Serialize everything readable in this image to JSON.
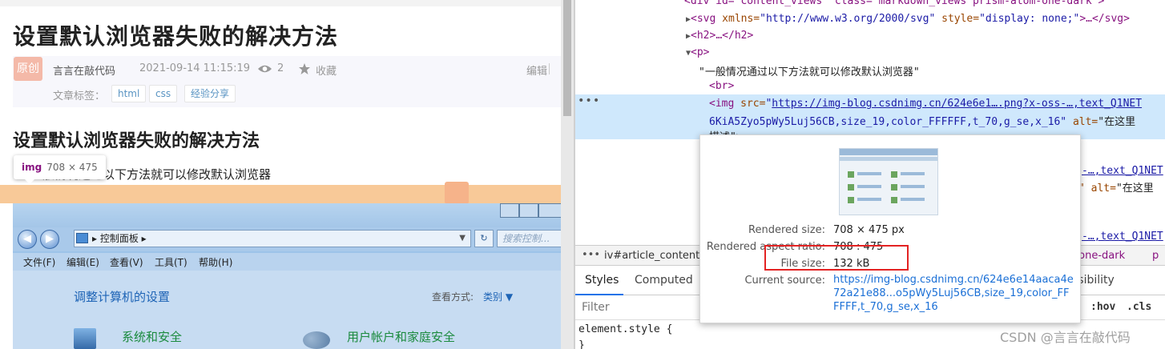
{
  "blog": {
    "title": "设置默认浏览器失败的解决方法",
    "original_badge": "原创",
    "author": "言言在敲代码",
    "datetime": "2021-09-14 11:15:19",
    "views": "2",
    "favorite": "收藏",
    "edit": "编辑",
    "tags_label": "文章标签：",
    "tags": [
      "html",
      "css",
      "经验分享"
    ],
    "section_heading": "设置默认浏览器失败的解决方法",
    "intro_text": "一般情况通过以下方法就可以修改默认浏览器",
    "img_tooltip": {
      "tag": "img",
      "dims": "708 × 475"
    }
  },
  "control_panel": {
    "address": "控制面板",
    "search_placeholder": "搜索控制...",
    "menu": [
      "文件(F)",
      "编辑(E)",
      "查看(V)",
      "工具(T)",
      "帮助(H)"
    ],
    "heading": "调整计算机的设置",
    "view_mode_label": "查看方式:",
    "view_mode_value": "类别 ▼",
    "system_security": "系统和安全",
    "user_accounts": "用户帐户和家庭安全"
  },
  "devtools": {
    "lines": {
      "l0": "<div id=\"content_views\" class=\"markdown_views prism-atom-one-dark\">",
      "l1_tag": "<svg ",
      "l1_attr": "xmlns=",
      "l1_val": "\"http://www.w3.org/2000/svg\"",
      "l1_attr2": " style=",
      "l1_val2": "\"display: none;\"",
      "l1_end": ">…</svg>",
      "l2": "<h2>…</h2>",
      "l3": "<p>",
      "l4_text": "\"一般情况通过以下方法就可以修改默认浏览器\"",
      "l5": "<br>",
      "l6_tag": "<img ",
      "l6_attr": "src=",
      "l6_link": "https://img-blog.csdnimg.cn/624e6e1….png?x-oss-…,text_Q1NET",
      "l7_val": "6KiA5Zyo5pWy5Luj56CB,size_19,color_FFFFFF,t_70,g_se,x_16\"",
      "l7_attr": " alt=",
      "l7_txt": "\"在这里",
      "l8_txt": "描述\">",
      "r1": "-…,text_Q1NET",
      "r2_attr": "\"  alt=",
      "r2_txt": "\"在这里",
      "r3": "-…,text_Q1NET"
    },
    "breadcrumb": "iv#article_content.",
    "breadcrumb_right": "n-one-dark",
    "breadcrumb_p": "p",
    "tabs": {
      "styles": "Styles",
      "computed": "Computed",
      "accessibility": "ssibility"
    },
    "filter_placeholder": "Filter",
    "hov": ":hov",
    "cls": ".cls",
    "element_style": "element.style {",
    "element_style_close": "}"
  },
  "popup": {
    "rendered_size_label": "Rendered size:",
    "rendered_size_value": "708 × 475 px",
    "aspect_label": "Rendered aspect ratio:",
    "aspect_value": "708 : 475",
    "file_size_label": "File size:",
    "file_size_value": "132 kB",
    "current_source_label": "Current source:",
    "current_source_value": "https://img-blog.csdnimg.cn/624e6e14aaca4e72a21e88...o5pWy5Luj56CB,size_19,color_FFFFFF,t_70,g_se,x_16"
  },
  "watermark": "CSDN @言言在敲代码",
  "colors": {
    "highlight_red": "#e32323",
    "link_blue": "#1a6fd6",
    "tag_purple": "#881280",
    "selection_blue": "#cfe8fc"
  }
}
